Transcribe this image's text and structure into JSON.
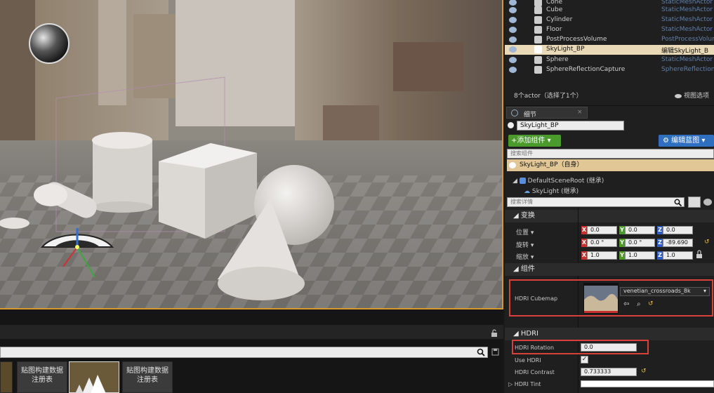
{
  "outliner": {
    "rows": [
      {
        "name": "Cone",
        "type": "StaticMeshActor"
      },
      {
        "name": "Cube",
        "type": "StaticMeshActor"
      },
      {
        "name": "Cylinder",
        "type": "StaticMeshActor"
      },
      {
        "name": "Floor",
        "type": "StaticMeshActor"
      },
      {
        "name": "PostProcessVolume",
        "type": "PostProcessVolum"
      },
      {
        "name": "SkyLight_BP",
        "type": "编辑SkyLight_B"
      },
      {
        "name": "Sphere",
        "type": "StaticMeshActor"
      },
      {
        "name": "SphereReflectionCapture",
        "type": "SphereReflection"
      }
    ],
    "count_label": "8个actor（选择了1个）",
    "view_options": "视图选项"
  },
  "details": {
    "tab": "细节",
    "actor_name": "SkyLight_BP",
    "add_component": "+添加组件",
    "edit_blueprint": "编辑蓝图",
    "search_components_placeholder": "搜索组件",
    "self_item": "SkyLight_BP（自身）",
    "root_item": "DefaultSceneRoot (继承)",
    "skylight_item": "SkyLight (继承)",
    "search_details_placeholder": "搜索详情",
    "transform_section": "变换",
    "location_label": "位置",
    "rotation_label": "旋转",
    "scale_label": "缩放",
    "location": {
      "x": "0.0",
      "y": "0.0",
      "z": "0.0"
    },
    "rotation": {
      "x": "0.0 °",
      "y": "0.0 °",
      "z": "-89.690"
    },
    "scale": {
      "x": "1.0",
      "y": "1.0",
      "z": "1.0"
    },
    "component_section": "组件",
    "hdri_cubemap_label": "HDRI Cubemap",
    "hdri_cubemap_value": "venetian_crossroads_8k",
    "hdri_section": "HDRI",
    "hdri_rotation_label": "HDRI Rotation",
    "hdri_rotation_value": "0.0",
    "use_hdri_label": "Use HDRI",
    "hdri_contrast_label": "HDRI Contrast",
    "hdri_contrast_value": "0.733333",
    "hdri_tint_label": "HDRI Tint"
  },
  "content_browser": {
    "thumb1": "贴图构建数据\n注册表",
    "thumb2": "贴图构建数据\n注册表"
  },
  "colors": {
    "accent_green": "#4c9a2a",
    "accent_blue": "#2f6fc0",
    "selection": "#e9d9b6",
    "highlight_red": "#d8413a",
    "viewport_border": "#d69a2a"
  }
}
